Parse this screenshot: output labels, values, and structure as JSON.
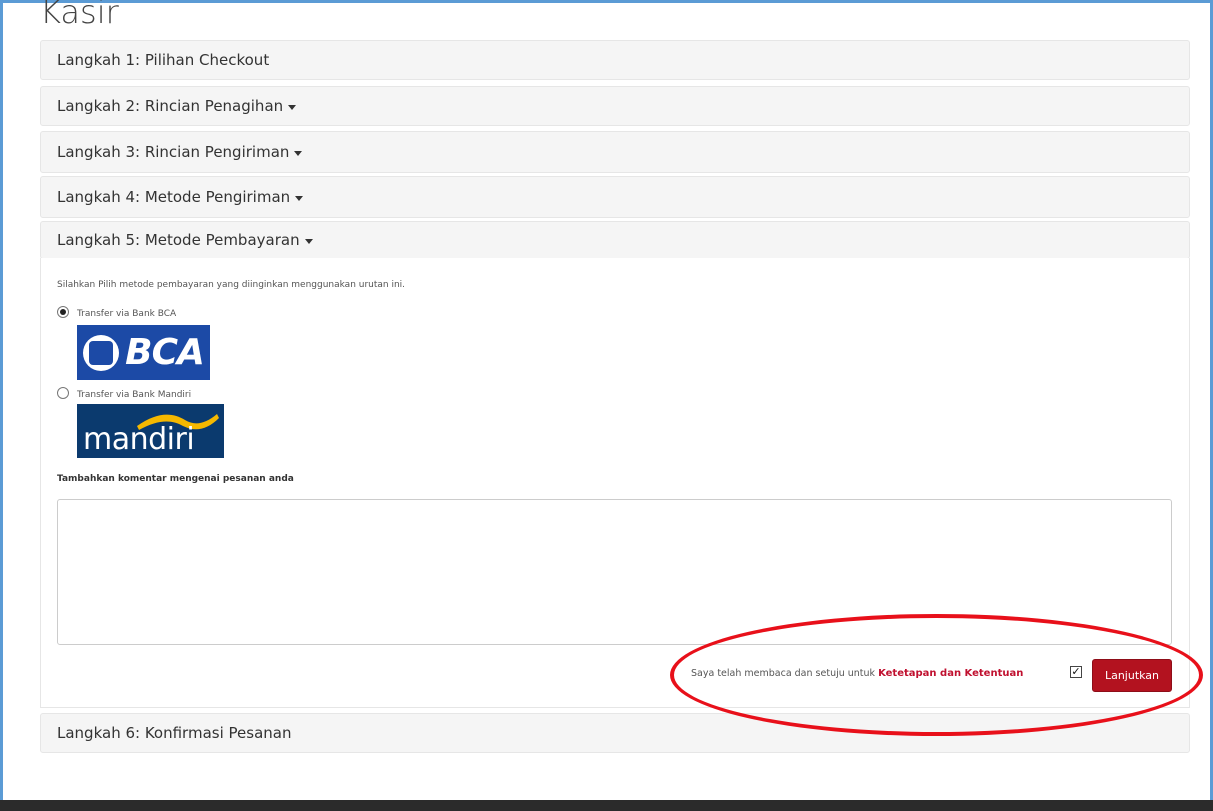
{
  "page": {
    "title": "Kasir"
  },
  "steps": [
    {
      "label": "Langkah 1: Pilihan Checkout",
      "has_caret": false
    },
    {
      "label": "Langkah 2: Rincian Penagihan",
      "has_caret": true
    },
    {
      "label": "Langkah 3: Rincian Pengiriman",
      "has_caret": true
    },
    {
      "label": "Langkah 4: Metode Pengiriman",
      "has_caret": true
    },
    {
      "label": "Langkah 5: Metode Pembayaran",
      "has_caret": true
    },
    {
      "label": "Langkah 6: Konfirmasi Pesanan",
      "has_caret": false
    }
  ],
  "payment": {
    "intro": "Silahkan Pilih metode pembayaran yang diinginkan menggunakan urutan ini.",
    "options": [
      {
        "label": "Transfer via Bank BCA",
        "selected": true,
        "logo_text": "BCA"
      },
      {
        "label": "Transfer via Bank Mandiri",
        "selected": false,
        "logo_text": "mandiri"
      }
    ],
    "comment_label": "Tambahkan komentar mengenai pesanan anda",
    "comment_value": ""
  },
  "agreement": {
    "text": "Saya telah membaca dan setuju untuk ",
    "link": "Ketetapan dan Ketentuan",
    "checked": true,
    "checkmark": "✓"
  },
  "actions": {
    "continue_label": "Lanjutkan"
  },
  "colors": {
    "accent": "#b3121f",
    "link": "#c0102f",
    "annotation": "#e8101a",
    "bca_blue": "#1c4aa6",
    "mandiri_navy": "#0b3a6e",
    "mandiri_gold": "#f5b800"
  }
}
